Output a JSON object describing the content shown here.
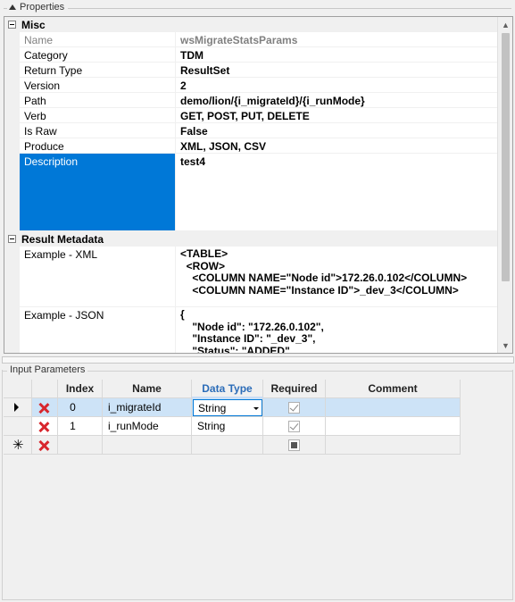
{
  "properties": {
    "title": "Properties",
    "categories": [
      {
        "label": "Misc",
        "rows": [
          {
            "name": "Name",
            "value": "wsMigrateStatsParams",
            "disabled": true
          },
          {
            "name": "Category",
            "value": "TDM"
          },
          {
            "name": "Return Type",
            "value": "ResultSet"
          },
          {
            "name": "Version",
            "value": "2"
          },
          {
            "name": "Path",
            "value": "demo/lion/{i_migrateId}/{i_runMode}"
          },
          {
            "name": "Verb",
            "value": "GET, POST, PUT, DELETE"
          },
          {
            "name": "Is Raw",
            "value": "False"
          },
          {
            "name": "Produce",
            "value": "XML, JSON, CSV"
          },
          {
            "name": "Description",
            "value": "test4",
            "selected": true
          }
        ]
      },
      {
        "label": "Result Metadata",
        "rows": [
          {
            "name": "Example - XML",
            "value": "<TABLE>\n  <ROW>\n    <COLUMN NAME=\"Node id\">172.26.0.102</COLUMN>\n    <COLUMN NAME=\"Instance ID\">_dev_3</COLUMN>"
          },
          {
            "name": "Example - JSON",
            "value": "{\n    \"Node id\": \"172.26.0.102\",\n    \"Instance ID\": \"_dev_3\",\n    \"Status\": \"ADDED\""
          }
        ]
      }
    ]
  },
  "input_parameters": {
    "title": "Input Parameters",
    "columns": [
      "Index",
      "Name",
      "Data Type",
      "Required",
      "Comment"
    ],
    "active_column": "Data Type",
    "rows": [
      {
        "index": "0",
        "name": "i_migrateId",
        "data_type": "String",
        "required": true,
        "comment": "",
        "current": true
      },
      {
        "index": "1",
        "name": "i_runMode",
        "data_type": "String",
        "required": true,
        "comment": ""
      }
    ]
  },
  "icons": {
    "collapse": "collapse-up-icon",
    "delete": "delete-x-icon",
    "current_row": "row-pointer-icon",
    "new_row": "new-row-star-icon"
  },
  "colors": {
    "selection": "#0078d7",
    "delete": "#d8262d",
    "current_row": "#cde3f7"
  }
}
